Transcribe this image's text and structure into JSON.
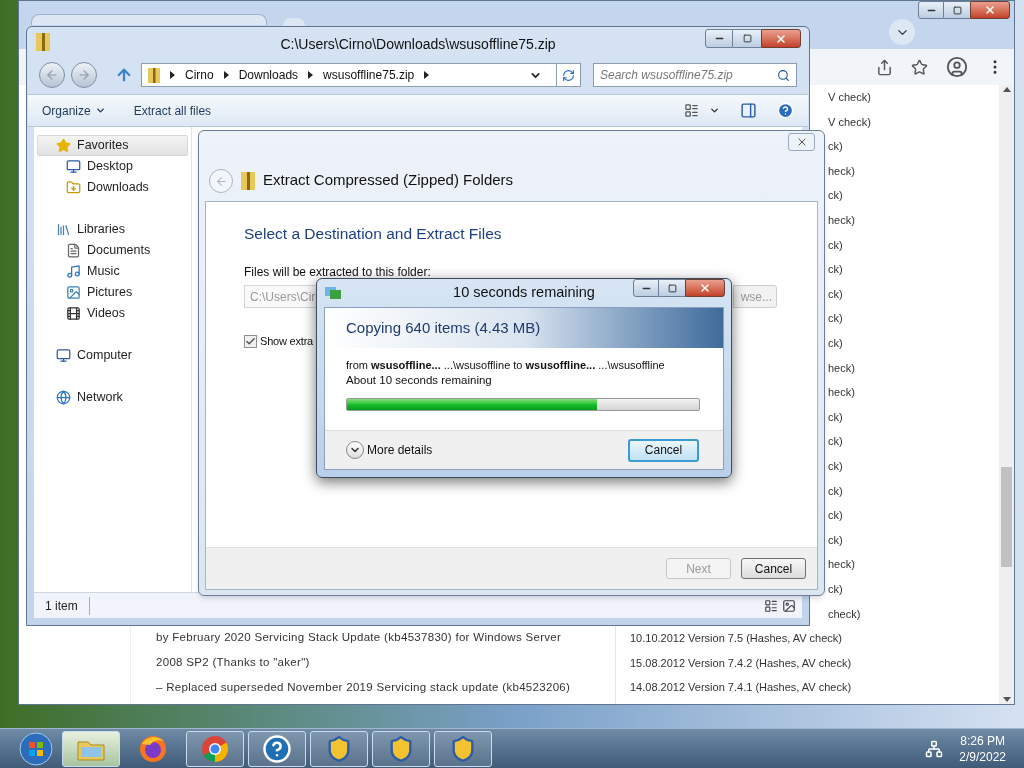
{
  "browser": {
    "page_left_lines": [
      "by February 2020 Servicing Stack Update (kb4537830) for Windows Server",
      "2008 SP2 (Thanks to \"aker\")",
      "– Replaced superseded November 2019 Servicing stack update (kb4523206)"
    ],
    "page_right_fragments": [
      "V check)",
      "V check)",
      "ck)",
      "heck)",
      "ck)",
      "heck)",
      "ck)",
      "ck)",
      "ck)",
      "ck)",
      "ck)",
      "heck)",
      "heck)",
      "ck)",
      "ck)",
      "ck)",
      "ck)",
      "ck)",
      "ck)",
      "heck)",
      "ck)",
      "check)"
    ],
    "page_right_lines": [
      "10.10.2012 Version 7.5 (Hashes, AV check)",
      "15.08.2012 Version 7.4.2 (Hashes, AV check)",
      "14.08.2012 Version 7.4.1 (Hashes, AV check)"
    ]
  },
  "explorer": {
    "title": "C:\\Users\\Cirno\\Downloads\\wsusoffline75.zip",
    "breadcrumb": [
      "Cirno",
      "Downloads",
      "wsusoffline75.zip"
    ],
    "search": {
      "placeholder": "Search wsusoffline75.zip"
    },
    "toolbar": [
      {
        "label": "Organize",
        "kind": "menu"
      },
      {
        "label": "Extract all files",
        "kind": "button"
      }
    ],
    "nav": [
      {
        "label": "Favorites",
        "kind": "star",
        "selected": true,
        "children": [
          {
            "label": "Desktop",
            "kind": "desktop",
            "selected": false
          },
          {
            "label": "Downloads",
            "kind": "downloads",
            "selected": false
          }
        ]
      },
      {
        "label": "Libraries",
        "kind": "library",
        "selected": false,
        "children": [
          {
            "label": "Documents",
            "kind": "document",
            "selected": false
          },
          {
            "label": "Music",
            "kind": "music",
            "selected": false
          },
          {
            "label": "Pictures",
            "kind": "pictures",
            "selected": false
          },
          {
            "label": "Videos",
            "kind": "videos",
            "selected": false
          }
        ]
      },
      {
        "label": "Computer",
        "kind": "computer",
        "selected": false
      },
      {
        "label": "Network",
        "kind": "network",
        "selected": false
      }
    ],
    "status": "1 item"
  },
  "wizard": {
    "title": "Extract Compressed (Zipped) Folders",
    "heading": "Select a Destination and Extract Files",
    "field_label": "Files will be extracted to this folder:",
    "field_value": "C:\\Users\\Cir",
    "browse": "wse...",
    "checkbox": {
      "label": "Show extra",
      "checked": true
    },
    "buttons": [
      {
        "label": "Next",
        "disabled": true
      },
      {
        "label": "Cancel",
        "disabled": false
      }
    ]
  },
  "progress": {
    "title": "10 seconds remaining",
    "header": "Copying 640 items (4.43 MB)",
    "from_line": "from **wsusoffline...** ...\\wsusoffline to **wsusoffline...** ...\\wsusoffline",
    "remaining": "About 10 seconds remaining",
    "level": 0.71,
    "more_details": "More details",
    "cancel": "Cancel"
  },
  "taskbar": {
    "apps": [
      {
        "kind": "explorer",
        "running": true,
        "selected": true
      },
      {
        "kind": "firefox",
        "running": false,
        "selected": false
      },
      {
        "kind": "chrome",
        "running": true,
        "selected": false
      },
      {
        "kind": "help",
        "running": true,
        "selected": false
      },
      {
        "kind": "shield",
        "running": true,
        "selected": false
      },
      {
        "kind": "shield",
        "running": true,
        "selected": false
      },
      {
        "kind": "shield",
        "running": true,
        "selected": false
      }
    ],
    "time": "8:26 PM",
    "date": "2/9/2022"
  }
}
